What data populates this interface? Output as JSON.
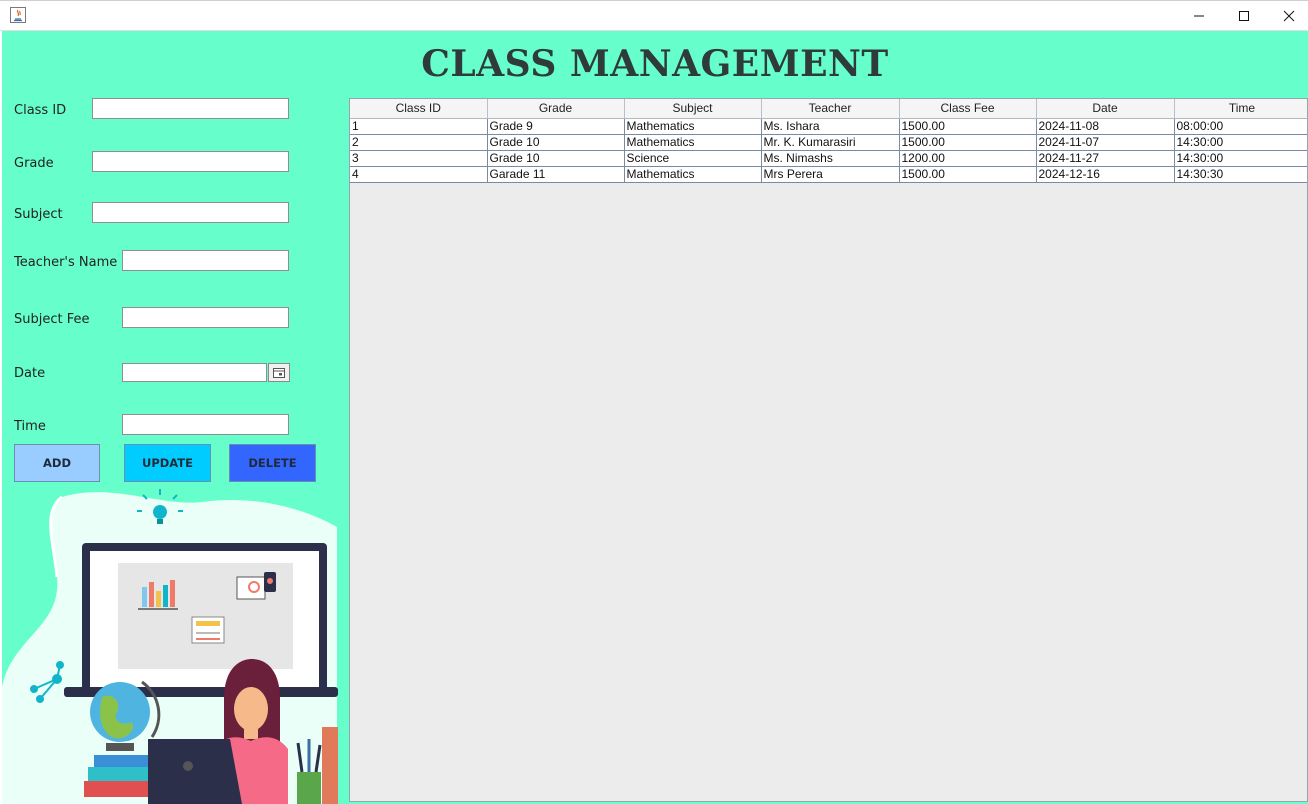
{
  "window": {
    "title": "",
    "icons": {
      "app": "java-icon",
      "minimize": "minimize-icon",
      "maximize": "maximize-icon",
      "close": "close-icon"
    }
  },
  "header": {
    "title": "CLASS MANAGEMENT"
  },
  "form": {
    "class_id_label": "Class ID",
    "grade_label": "Grade",
    "subject_label": "Subject",
    "teacher_label": "Teacher's Name",
    "fee_label": "Subject Fee",
    "date_label": "Date",
    "time_label": "Time",
    "class_id_value": "",
    "grade_value": "",
    "subject_value": "",
    "teacher_value": "",
    "fee_value": "",
    "date_value": "",
    "time_value": "",
    "calendar_icon": "calendar-icon"
  },
  "buttons": {
    "add": "ADD",
    "update": "UPDATE",
    "delete": "DELETE"
  },
  "table": {
    "columns": [
      "Class ID",
      "Grade",
      "Subject",
      "Teacher",
      "Class Fee",
      "Date",
      "Time"
    ],
    "rows": [
      [
        "1",
        "Grade 9",
        "Mathematics",
        "Ms. Ishara",
        "1500.00",
        "2024-11-08",
        "08:00:00"
      ],
      [
        "2",
        "Grade 10",
        "Mathematics",
        "Mr. K. Kumarasiri",
        "1500.00",
        "2024-11-07",
        "14:30:00"
      ],
      [
        "3",
        "Grade 10",
        "Science",
        "Ms. Nimashs",
        "1200.00",
        "2024-11-27",
        "14:30:00"
      ],
      [
        "4",
        "Garade 11",
        "Mathematics",
        "Mrs Perera",
        "1500.00",
        "2024-12-16",
        "14:30:30"
      ]
    ]
  },
  "colors": {
    "background": "#66ffcc",
    "add_button": "#99ccff",
    "update_button": "#00ccff",
    "delete_button": "#3366ff"
  }
}
